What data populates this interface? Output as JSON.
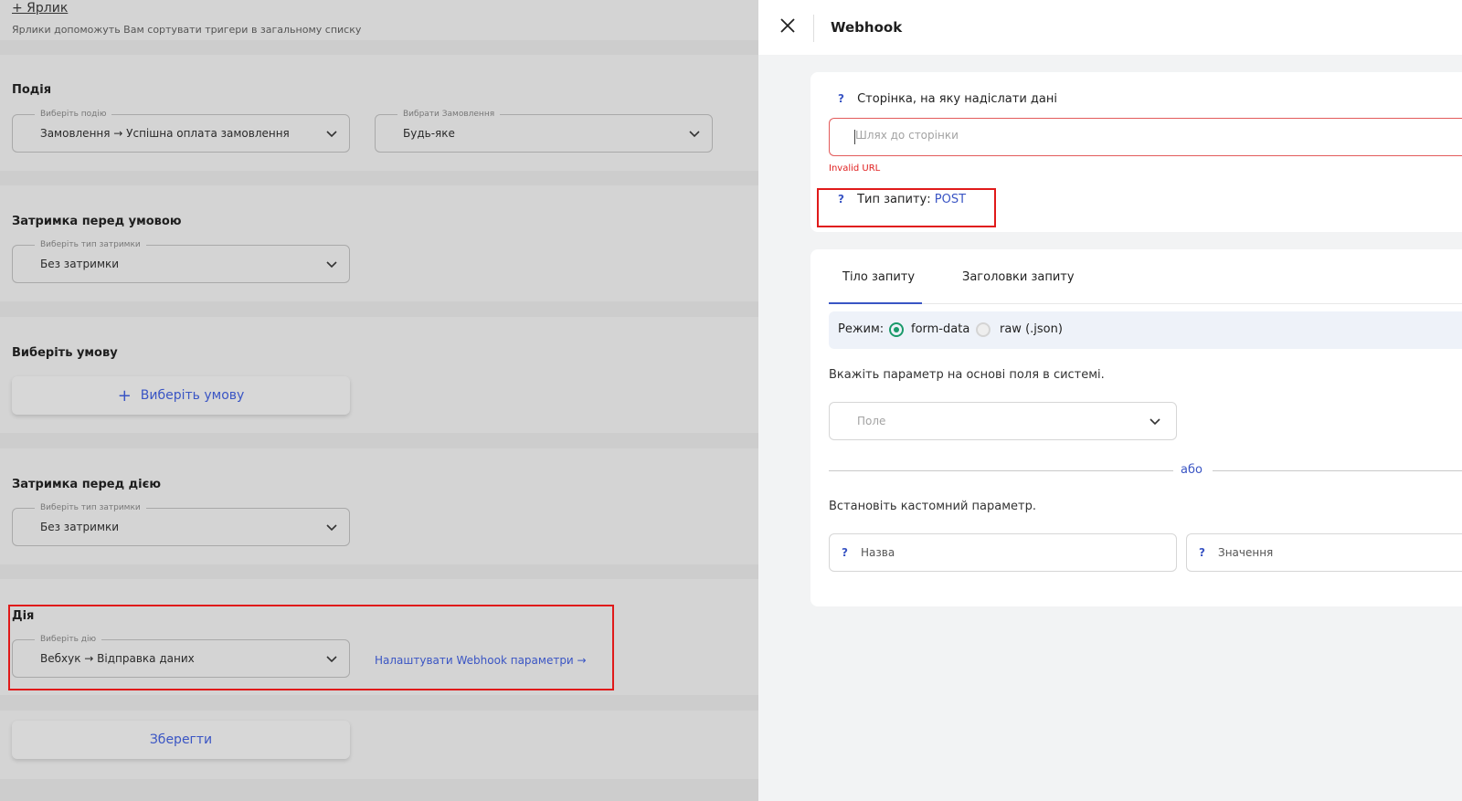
{
  "left": {
    "tag_link": "+ Ярлик",
    "tag_hint": "Ярлики допоможуть Вам сортувати тригери в загальному списку",
    "event": {
      "title": "Подія",
      "event_select": {
        "legend": "Виберіть подію",
        "value": "Замовлення → Успішна оплата замовлення"
      },
      "order_select": {
        "legend": "Вибрати Замовлення",
        "value": "Будь-яке"
      }
    },
    "delay_before_condition": {
      "title": "Затримка перед умовою",
      "select": {
        "legend": "Виберіть тип затримки",
        "value": "Без затримки"
      }
    },
    "condition": {
      "title": "Виберіть умову",
      "button_label": "Виберіть умову"
    },
    "delay_before_action": {
      "title": "Затримка перед дією",
      "select": {
        "legend": "Виберіть тип затримки",
        "value": "Без затримки"
      }
    },
    "action": {
      "title": "Дія",
      "select": {
        "legend": "Виберіть дію",
        "value": "Вебхук → Відправка даних"
      },
      "configure_link": "Налаштувати Webhook параметри →"
    },
    "save_label": "Зберегти"
  },
  "drawer": {
    "title": "Webhook",
    "url": {
      "q": "?",
      "label": "Сторінка, на яку надіслати дані",
      "placeholder": "Шлях до сторінки",
      "value": "",
      "error": "Invalid URL"
    },
    "request_type": {
      "q": "?",
      "label": "Тип запиту:",
      "method": "POST"
    },
    "tabs": [
      {
        "label": "Тіло запиту",
        "active": true
      },
      {
        "label": "Заголовки запиту",
        "active": false
      }
    ],
    "mode": {
      "label": "Режим:",
      "options": [
        {
          "label": "form-data",
          "selected": true
        },
        {
          "label": "raw (.json)",
          "selected": false
        }
      ]
    },
    "field_hint": "Вкажіть параметр на основі поля в системі.",
    "field_placeholder": "Поле",
    "or_text": "або",
    "custom_hint": "Встановіть кастомний параметр.",
    "custom_name": {
      "q": "?",
      "placeholder": "Назва"
    },
    "custom_value": {
      "q": "?",
      "placeholder": "Значення"
    }
  },
  "colors": {
    "accent": "#3a55c4",
    "error": "#e02020",
    "radio_on": "#1a9a6a",
    "highlight": "#e01a1a"
  },
  "icons": {
    "close": "close-icon",
    "chevron": "chevron-down-icon",
    "plus": "plus-icon"
  }
}
